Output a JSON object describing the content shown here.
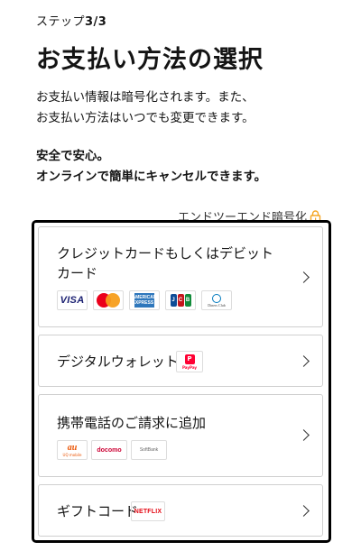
{
  "header": {
    "step_prefix": "ステップ",
    "step_value": "3/3",
    "title": "お支払い方法の選択"
  },
  "description": {
    "line1": "お支払い情報は暗号化されます。また、",
    "line2": "お支払い方法はいつでも変更できます。",
    "bold_line1": "安全で安心。",
    "bold_line2": "オンラインで簡単にキャンセルできます。"
  },
  "encryption": {
    "label": "エンドツーエンド暗号化",
    "icon": "lock-icon",
    "color": "#f5a623"
  },
  "options": [
    {
      "label": "クレジットカードもしくはデビットカード",
      "logos": [
        "VISA",
        "Mastercard",
        "AMEX",
        "JCB",
        "Diners Club"
      ]
    },
    {
      "label": "デジタルウォレット",
      "logos": [
        "PayPay"
      ]
    },
    {
      "label": "携帯電話のご請求に追加",
      "logos": [
        "au",
        "docomo",
        "SoftBank"
      ]
    },
    {
      "label": "ギフトコード",
      "logos": [
        "NETFLIX"
      ]
    }
  ],
  "logo_text": {
    "visa": "VISA",
    "amex": "AMERICAN EXPRESS",
    "jcb_j": "J",
    "jcb_c": "C",
    "jcb_b": "B",
    "diners": "Diners Club",
    "paypay_mark": "P",
    "paypay": "PayPay",
    "au": "au",
    "au_sub": "UQ mobile",
    "docomo": "docomo",
    "softbank": "SoftBank",
    "netflix": "NETFLIX"
  },
  "colors": {
    "visa": "#1a1f71",
    "mastercard_red": "#eb001b",
    "mastercard_orange": "#f79e1b",
    "amex": "#2e77bc",
    "paypay": "#ff0033",
    "au": "#eb5505",
    "docomo": "#cc0033",
    "netflix": "#e50914",
    "frame": "#000000"
  }
}
